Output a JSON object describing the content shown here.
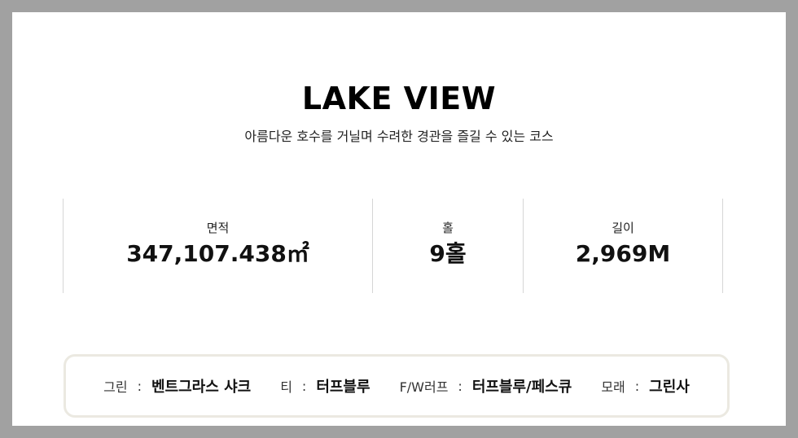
{
  "course": {
    "title": "LAKE VIEW",
    "description": "아름다운 호수를 거닐며 수려한 경관을 즐길 수 있는 코스"
  },
  "stats": [
    {
      "label": "면적",
      "value": "347,107.438㎡"
    },
    {
      "label": "홀",
      "value": "9홀"
    },
    {
      "label": "길이",
      "value": "2,969M"
    }
  ],
  "specs": [
    {
      "label": "그린",
      "separator": ":",
      "value": "벤트그라스 샤크"
    },
    {
      "label": "티",
      "separator": ":",
      "value": "터프블루"
    },
    {
      "label": "F/W러프",
      "separator": ":",
      "value": "터프블루/페스큐"
    },
    {
      "label": "모래",
      "separator": ":",
      "value": "그린사"
    }
  ],
  "colors": {
    "page_background": "#a1a1a1",
    "card_background": "#ffffff",
    "divider": "#d6d6d6",
    "spec_border": "#ebe9e1",
    "text": "#111111"
  }
}
